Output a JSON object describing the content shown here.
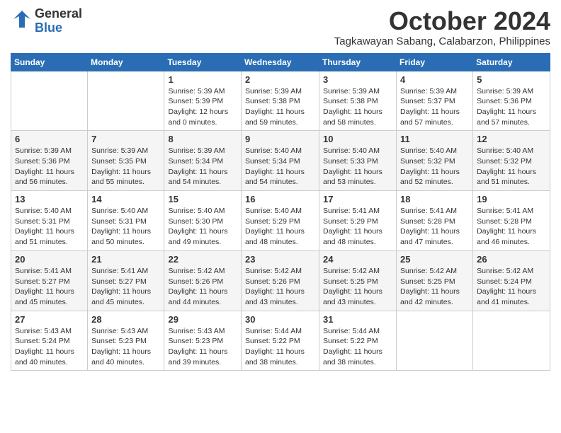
{
  "header": {
    "logo_general": "General",
    "logo_blue": "Blue",
    "month": "October 2024",
    "location": "Tagkawayan Sabang, Calabarzon, Philippines"
  },
  "weekdays": [
    "Sunday",
    "Monday",
    "Tuesday",
    "Wednesday",
    "Thursday",
    "Friday",
    "Saturday"
  ],
  "weeks": [
    [
      {
        "day": "",
        "detail": ""
      },
      {
        "day": "",
        "detail": ""
      },
      {
        "day": "1",
        "detail": "Sunrise: 5:39 AM\nSunset: 5:39 PM\nDaylight: 12 hours\nand 0 minutes."
      },
      {
        "day": "2",
        "detail": "Sunrise: 5:39 AM\nSunset: 5:38 PM\nDaylight: 11 hours\nand 59 minutes."
      },
      {
        "day": "3",
        "detail": "Sunrise: 5:39 AM\nSunset: 5:38 PM\nDaylight: 11 hours\nand 58 minutes."
      },
      {
        "day": "4",
        "detail": "Sunrise: 5:39 AM\nSunset: 5:37 PM\nDaylight: 11 hours\nand 57 minutes."
      },
      {
        "day": "5",
        "detail": "Sunrise: 5:39 AM\nSunset: 5:36 PM\nDaylight: 11 hours\nand 57 minutes."
      }
    ],
    [
      {
        "day": "6",
        "detail": "Sunrise: 5:39 AM\nSunset: 5:36 PM\nDaylight: 11 hours\nand 56 minutes."
      },
      {
        "day": "7",
        "detail": "Sunrise: 5:39 AM\nSunset: 5:35 PM\nDaylight: 11 hours\nand 55 minutes."
      },
      {
        "day": "8",
        "detail": "Sunrise: 5:39 AM\nSunset: 5:34 PM\nDaylight: 11 hours\nand 54 minutes."
      },
      {
        "day": "9",
        "detail": "Sunrise: 5:40 AM\nSunset: 5:34 PM\nDaylight: 11 hours\nand 54 minutes."
      },
      {
        "day": "10",
        "detail": "Sunrise: 5:40 AM\nSunset: 5:33 PM\nDaylight: 11 hours\nand 53 minutes."
      },
      {
        "day": "11",
        "detail": "Sunrise: 5:40 AM\nSunset: 5:32 PM\nDaylight: 11 hours\nand 52 minutes."
      },
      {
        "day": "12",
        "detail": "Sunrise: 5:40 AM\nSunset: 5:32 PM\nDaylight: 11 hours\nand 51 minutes."
      }
    ],
    [
      {
        "day": "13",
        "detail": "Sunrise: 5:40 AM\nSunset: 5:31 PM\nDaylight: 11 hours\nand 51 minutes."
      },
      {
        "day": "14",
        "detail": "Sunrise: 5:40 AM\nSunset: 5:31 PM\nDaylight: 11 hours\nand 50 minutes."
      },
      {
        "day": "15",
        "detail": "Sunrise: 5:40 AM\nSunset: 5:30 PM\nDaylight: 11 hours\nand 49 minutes."
      },
      {
        "day": "16",
        "detail": "Sunrise: 5:40 AM\nSunset: 5:29 PM\nDaylight: 11 hours\nand 48 minutes."
      },
      {
        "day": "17",
        "detail": "Sunrise: 5:41 AM\nSunset: 5:29 PM\nDaylight: 11 hours\nand 48 minutes."
      },
      {
        "day": "18",
        "detail": "Sunrise: 5:41 AM\nSunset: 5:28 PM\nDaylight: 11 hours\nand 47 minutes."
      },
      {
        "day": "19",
        "detail": "Sunrise: 5:41 AM\nSunset: 5:28 PM\nDaylight: 11 hours\nand 46 minutes."
      }
    ],
    [
      {
        "day": "20",
        "detail": "Sunrise: 5:41 AM\nSunset: 5:27 PM\nDaylight: 11 hours\nand 45 minutes."
      },
      {
        "day": "21",
        "detail": "Sunrise: 5:41 AM\nSunset: 5:27 PM\nDaylight: 11 hours\nand 45 minutes."
      },
      {
        "day": "22",
        "detail": "Sunrise: 5:42 AM\nSunset: 5:26 PM\nDaylight: 11 hours\nand 44 minutes."
      },
      {
        "day": "23",
        "detail": "Sunrise: 5:42 AM\nSunset: 5:26 PM\nDaylight: 11 hours\nand 43 minutes."
      },
      {
        "day": "24",
        "detail": "Sunrise: 5:42 AM\nSunset: 5:25 PM\nDaylight: 11 hours\nand 43 minutes."
      },
      {
        "day": "25",
        "detail": "Sunrise: 5:42 AM\nSunset: 5:25 PM\nDaylight: 11 hours\nand 42 minutes."
      },
      {
        "day": "26",
        "detail": "Sunrise: 5:42 AM\nSunset: 5:24 PM\nDaylight: 11 hours\nand 41 minutes."
      }
    ],
    [
      {
        "day": "27",
        "detail": "Sunrise: 5:43 AM\nSunset: 5:24 PM\nDaylight: 11 hours\nand 40 minutes."
      },
      {
        "day": "28",
        "detail": "Sunrise: 5:43 AM\nSunset: 5:23 PM\nDaylight: 11 hours\nand 40 minutes."
      },
      {
        "day": "29",
        "detail": "Sunrise: 5:43 AM\nSunset: 5:23 PM\nDaylight: 11 hours\nand 39 minutes."
      },
      {
        "day": "30",
        "detail": "Sunrise: 5:44 AM\nSunset: 5:22 PM\nDaylight: 11 hours\nand 38 minutes."
      },
      {
        "day": "31",
        "detail": "Sunrise: 5:44 AM\nSunset: 5:22 PM\nDaylight: 11 hours\nand 38 minutes."
      },
      {
        "day": "",
        "detail": ""
      },
      {
        "day": "",
        "detail": ""
      }
    ]
  ]
}
